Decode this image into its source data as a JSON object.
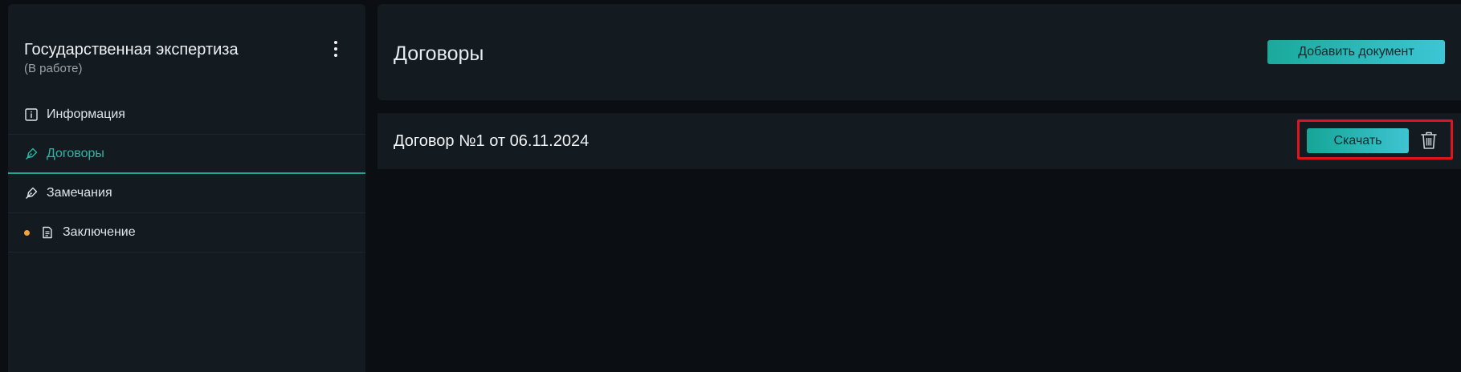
{
  "sidebar": {
    "title": "Государственная экспертиза",
    "status": "(В работе)",
    "items": [
      {
        "label": "Информация",
        "icon": "info-icon"
      },
      {
        "label": "Договоры",
        "icon": "pen-icon",
        "active": true
      },
      {
        "label": "Замечания",
        "icon": "pen-icon"
      },
      {
        "label": "Заключение",
        "icon": "document-icon",
        "dot": true
      }
    ]
  },
  "header": {
    "title": "Договоры",
    "add_label": "Добавить документ"
  },
  "documents": [
    {
      "title": "Договор №1 от 06.11.2024",
      "download_label": "Скачать"
    }
  ],
  "colors": {
    "accent": "#1fa795",
    "highlight": "#e0141d",
    "dot": "#f2a33a"
  }
}
